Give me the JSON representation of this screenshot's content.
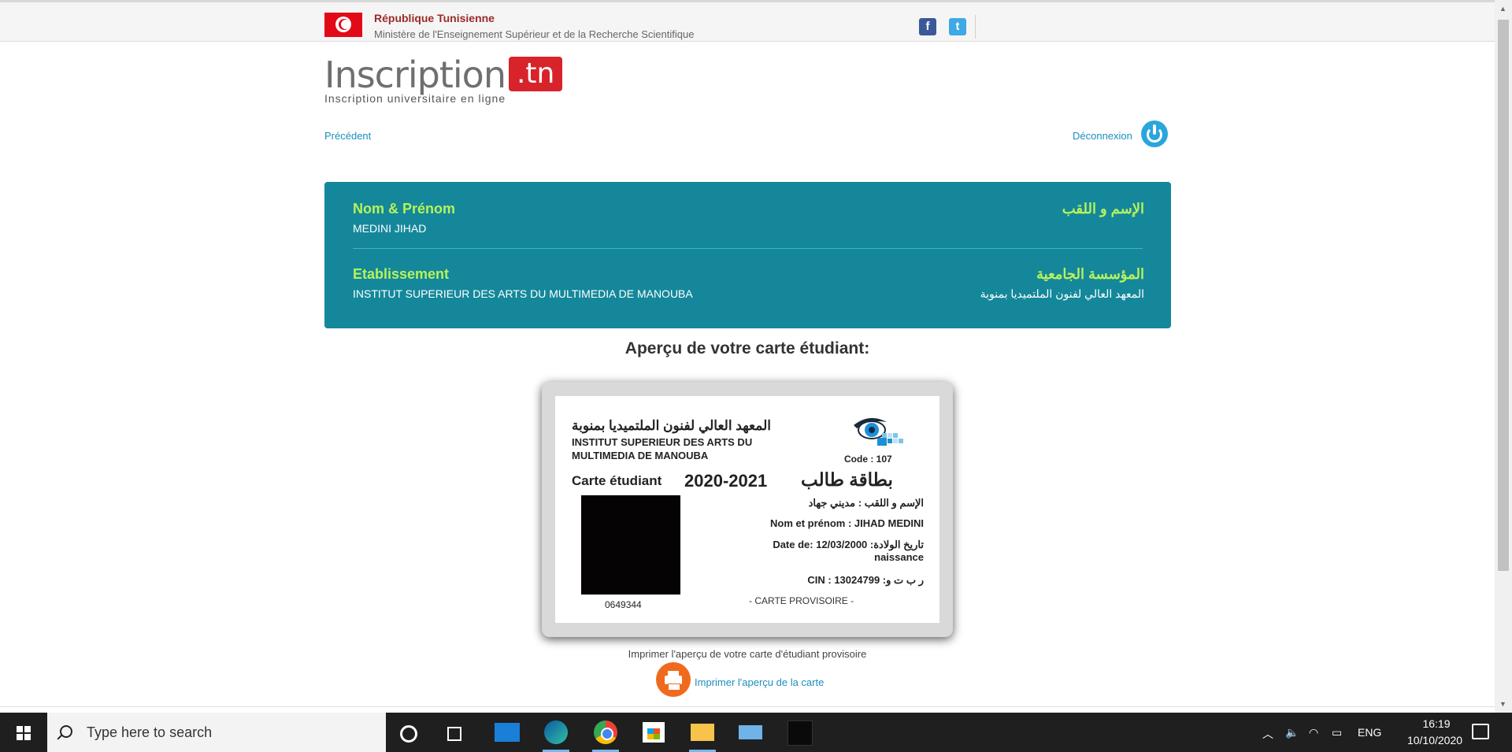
{
  "gov_bar": {
    "title": "République Tunisienne",
    "subtitle": "Ministère de l'Enseignement Supérieur et de la Recherche Scientifique",
    "social": [
      {
        "name": "facebook-icon",
        "glyph": "f"
      },
      {
        "name": "twitter-icon",
        "glyph": "t"
      }
    ]
  },
  "logo": {
    "main": "Inscription",
    "suffix": ".tn",
    "tagline": "Inscription universitaire en ligne"
  },
  "nav": {
    "previous": "Précédent",
    "logout": "Déconnexion"
  },
  "student_info": {
    "name_label_fr": "Nom & Prénom",
    "name_label_ar": "الإسم و اللقب",
    "name_value": "MEDINI JIHAD",
    "institution_label_fr": "Etablissement",
    "institution_label_ar": "المؤسسة الجامعية",
    "institution_value_fr": "INSTITUT SUPERIEUR DES ARTS DU MULTIMEDIA DE MANOUBA",
    "institution_value_ar": "المعهد العالي لفنون الملتميديا بمنوبة"
  },
  "preview_title": "Aperçu de votre carte étudiant:",
  "card": {
    "institution_ar": "المعهد العالي لفنون الملتميديا بمنوبة",
    "institution_fr_line1": "INSTITUT SUPERIEUR DES ARTS DU",
    "institution_fr_line2": "MULTIMEDIA DE MANOUBA",
    "logo_text": "isamm",
    "code": "Code : 107",
    "label_fr": "Carte étudiant",
    "year": "2020-2021",
    "label_ar": "بطاقة طالب",
    "name_ar": "الإسم و اللقب : مديني جهاد",
    "name_fr": "Nom et prénom : JIHAD MEDINI",
    "birth_line1": "Date de: 12/03/2000 :تاريخ الولادة",
    "birth_line2": "naissance",
    "cin": "CIN : 13024799 :ر ب ت و",
    "photo_number": "0649344",
    "provisional": "- CARTE PROVISOIRE -"
  },
  "print": {
    "hint": "Imprimer l'aperçu de votre carte d'étudiant provisoire",
    "link": "Imprimer l'aperçu de la carte"
  },
  "taskbar": {
    "search_placeholder": "Type here to search",
    "language": "ENG",
    "time": "16:19",
    "date": "10/10/2020",
    "apps": [
      "cortana-icon",
      "task-view-icon",
      "mail-icon",
      "edge-icon",
      "chrome-icon",
      "store-icon",
      "file-explorer-icon",
      "pc-icon",
      "app-icon"
    ]
  },
  "colors": {
    "panel": "#14889a",
    "label_green": "#b7f25b",
    "link": "#1b8fbf",
    "print_orange": "#f06a1e",
    "flag_red": "#e30a17"
  }
}
